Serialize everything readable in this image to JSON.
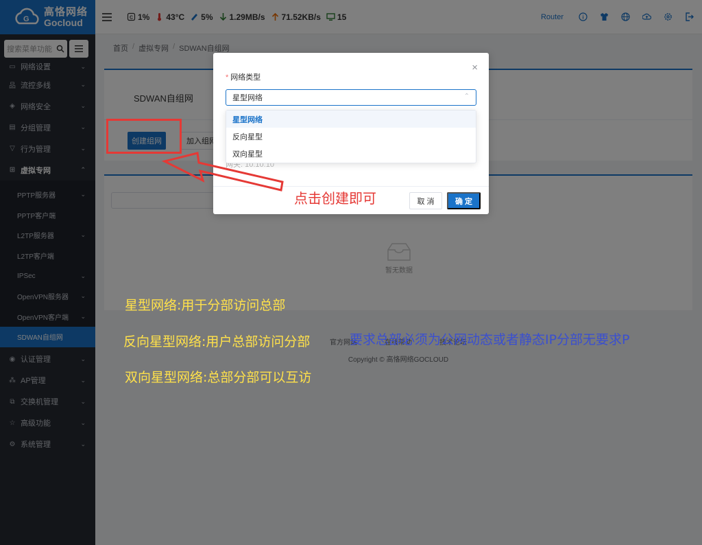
{
  "sidebar": {
    "logo_cn": "高恪网络",
    "logo_en": "Gocloud",
    "search_placeholder": "搜索菜单功能",
    "items": [
      {
        "label": "网络设置",
        "icon": "monitor-icon"
      },
      {
        "label": "流控多线",
        "icon": "flow-icon"
      },
      {
        "label": "网络安全",
        "icon": "shield-icon"
      },
      {
        "label": "分组管理",
        "icon": "group-icon"
      },
      {
        "label": "行为管理",
        "icon": "filter-icon"
      },
      {
        "label": "虚拟专网",
        "icon": "vpn-icon"
      }
    ],
    "sub_items": [
      {
        "label": "PPTP服务器",
        "chevron": true
      },
      {
        "label": "PPTP客户端",
        "chevron": false
      },
      {
        "label": "L2TP服务器",
        "chevron": true
      },
      {
        "label": "L2TP客户端",
        "chevron": false
      },
      {
        "label": "IPSec",
        "chevron": true
      },
      {
        "label": "OpenVPN服务器",
        "chevron": true
      },
      {
        "label": "OpenVPN客户端",
        "chevron": true
      },
      {
        "label": "SDWAN自组网",
        "chevron": false
      }
    ],
    "bottom_items": [
      {
        "label": "认证管理",
        "icon": "auth-icon"
      },
      {
        "label": "AP管理",
        "icon": "ap-icon"
      },
      {
        "label": "交换机管理",
        "icon": "switch-icon"
      },
      {
        "label": "高级功能",
        "icon": "star-icon"
      },
      {
        "label": "系统管理",
        "icon": "settings-icon"
      }
    ]
  },
  "topbar": {
    "cpu": "1%",
    "temp": "43°C",
    "mem": "5%",
    "down": "1.29MB/s",
    "up": "71.52KB/s",
    "devices": "15",
    "router_label": "Router"
  },
  "breadcrumb": {
    "home": "首页",
    "parent": "虚拟专网",
    "current": "SDWAN自组网",
    "sep": "/"
  },
  "main": {
    "title": "SDWAN自组网",
    "create_btn": "创建组网",
    "join_btn": "加入组网",
    "empty_text": "暂无数据",
    "footer_links": [
      "官方网站",
      "在线帮助",
      "技术论坛"
    ],
    "copyright": "Copyright © 高恪网络GOCLOUD"
  },
  "modal": {
    "field_label": "网络类型",
    "required_mark": "*",
    "selected_value": "星型网络",
    "options": [
      "星型网络",
      "反向星型",
      "双向星型"
    ],
    "behind_text": "网关: 10.10.10",
    "cancel": "取 消",
    "confirm": "确 定",
    "close": "×"
  },
  "annotations": {
    "click_hint": "点击创建即可",
    "star_desc": "星型网络:用于分部访问总部",
    "reverse_desc": "反向星型网络:用户总部访问分部",
    "bi_desc": "双向星型网络:总部分部可以互访",
    "requirement": "要求总部必须为公网动态或者静态IP分部无要求P"
  },
  "colors": {
    "brand": "#1a73c9",
    "sidebar_bg": "#262b33",
    "annotation_red": "#e53935",
    "annotation_yellow": "#ffe14a",
    "annotation_blue": "#3a4fd0"
  }
}
